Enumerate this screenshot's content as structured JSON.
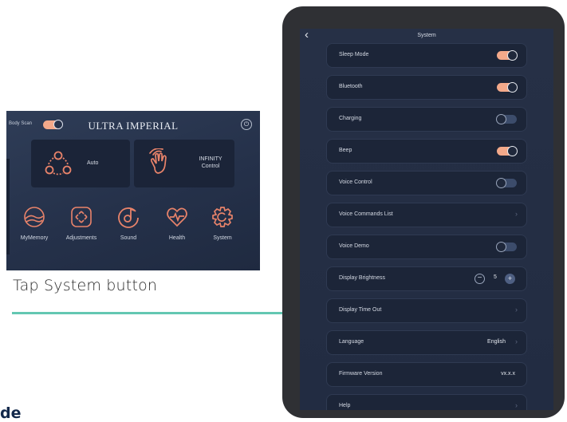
{
  "home_screen": {
    "body_scan_label": "Body Scan",
    "body_scan_on": true,
    "title": "ULTRA IMPERIAL",
    "modes": [
      {
        "label": "Auto"
      },
      {
        "label_line1": "INFINITY",
        "label_line2": "Control"
      }
    ],
    "tiles": [
      {
        "label": "MyMemory",
        "icon": "memory-icon"
      },
      {
        "label": "Adjustments",
        "icon": "adjustments-icon"
      },
      {
        "label": "Sound",
        "icon": "sound-icon"
      },
      {
        "label": "Health",
        "icon": "health-icon"
      },
      {
        "label": "System",
        "icon": "system-icon"
      }
    ]
  },
  "caption": "Tap System button",
  "cut_text": "de",
  "system_screen": {
    "title": "System",
    "rows": [
      {
        "label": "Sleep Mode",
        "control": "toggle",
        "on": true
      },
      {
        "label": "Bluetooth",
        "control": "toggle",
        "on": true
      },
      {
        "label": "Charging",
        "control": "toggle",
        "on": false
      },
      {
        "label": "Beep",
        "control": "toggle",
        "on": true
      },
      {
        "label": "Voice Control",
        "control": "toggle",
        "on": false
      },
      {
        "label": "Voice Commands List",
        "control": "chevron"
      },
      {
        "label": "Voice Demo",
        "control": "toggle",
        "on": false
      },
      {
        "label": "Display Brightness",
        "control": "stepper",
        "value": "5"
      },
      {
        "label": "Display Time Out",
        "control": "chevron"
      },
      {
        "label": "Language",
        "control": "value-chevron",
        "value": "English"
      },
      {
        "label": "Firmware Version",
        "control": "value",
        "value": "vx.x.x"
      },
      {
        "label": "Help",
        "control": "chevron"
      }
    ]
  },
  "colors": {
    "accent": "#f3a98a",
    "arrow": "#63c7b2",
    "panel": "#25314a",
    "icon_orange": "#e8836a"
  }
}
